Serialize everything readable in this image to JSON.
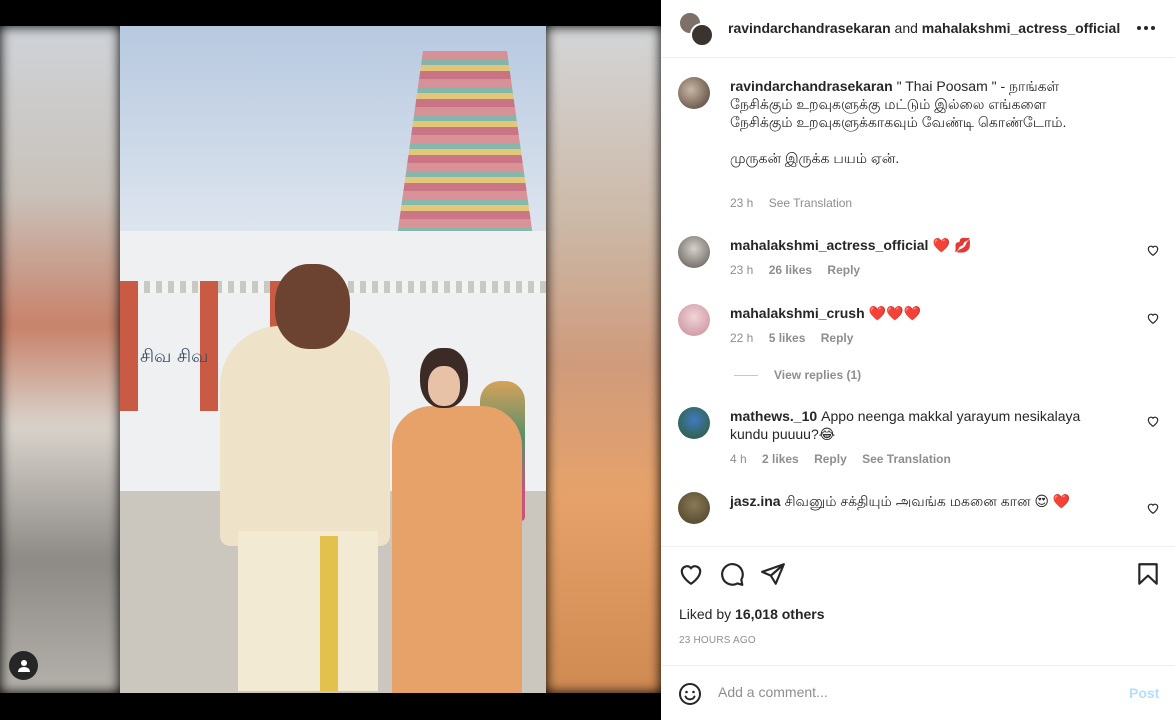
{
  "media": {
    "temple_sign": "சிவ சிவ"
  },
  "header": {
    "user1": "ravindarchandrasekaran",
    "connector": "and",
    "user2": "mahalakshmi_actress_official"
  },
  "caption": {
    "user": "ravindarchandrasekaran",
    "line1": "\" Thai Poosam \" - நாங்கள் நேசிக்கும் உறவுகளுக்கு மட்டும் இல்லை எங்களை நேசிக்கும் உறவுகளுக்காகவும் வேண்டி கொண்டோம்.",
    "line2": "முருகன் இருக்க பயம் ஏன்.",
    "time": "23 h",
    "see_translation": "See Translation"
  },
  "comments": [
    {
      "user": "mahalakshmi_actress_official",
      "text": "❤️ 💋",
      "time": "23 h",
      "likes": "26 likes",
      "reply": "Reply"
    },
    {
      "user": "mahalakshmi_crush",
      "text": "❤️❤️❤️",
      "time": "22 h",
      "likes": "5 likes",
      "reply": "Reply"
    },
    {
      "user": "mathews._10",
      "text": "Appo neenga makkal yarayum nesikalaya kundu puuuu?😂",
      "time": "4 h",
      "likes": "2 likes",
      "reply": "Reply",
      "see_translation": "See Translation"
    },
    {
      "user": "jasz.ina",
      "text": "சிவனும் சக்தியும் அவங்க மகனை கான 😍 ❤️"
    }
  ],
  "view_replies": "View replies (1)",
  "likes": {
    "prefix": "Liked by",
    "count": "16,018 others"
  },
  "time_ago": "23 HOURS AGO",
  "add_comment": {
    "placeholder": "Add a comment...",
    "post": "Post"
  },
  "colors": {
    "heart_red": "#ed1c4a",
    "post_blue": "#b2dffc",
    "muted": "#8e8e8e"
  }
}
